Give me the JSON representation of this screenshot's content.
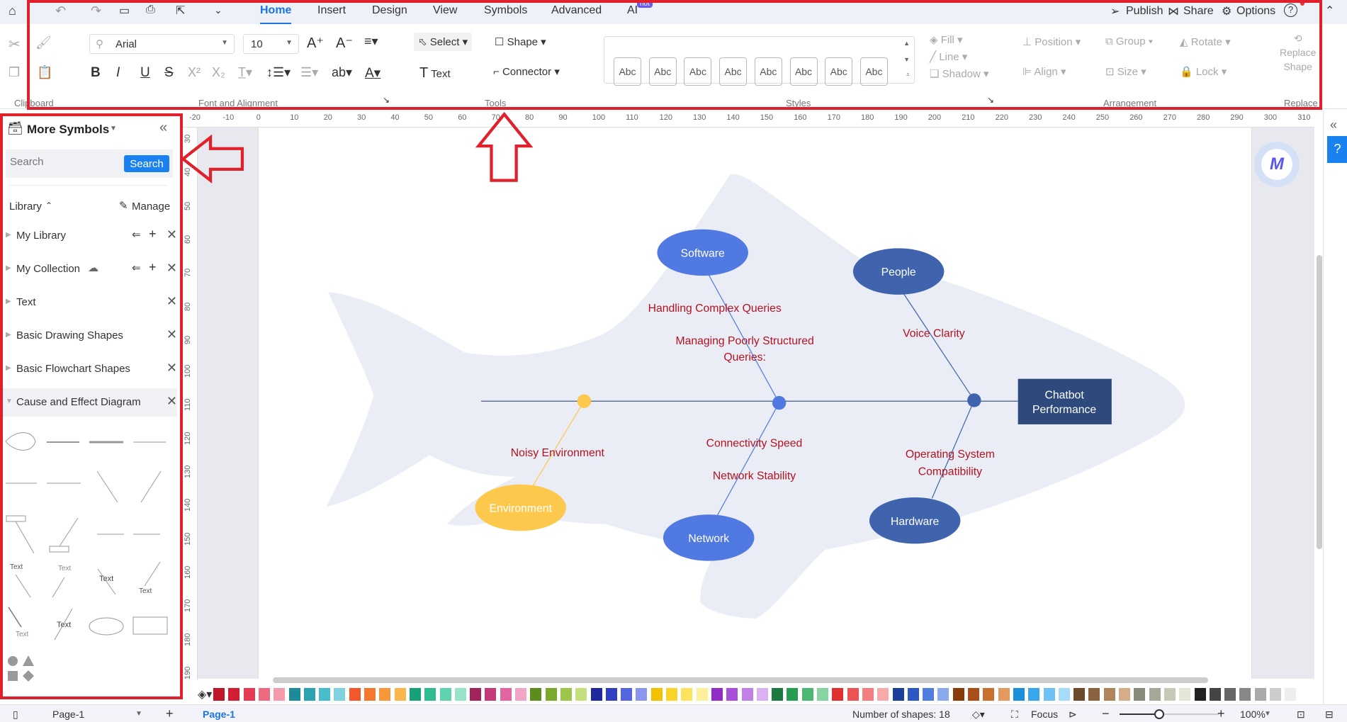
{
  "tabbar": {
    "tabs": [
      "Home",
      "Insert",
      "Design",
      "View",
      "Symbols",
      "Advanced",
      "AI"
    ],
    "active": "Home",
    "ai_badge": "hot",
    "right": {
      "publish": "Publish",
      "share": "Share",
      "options": "Options"
    }
  },
  "ribbon": {
    "font": {
      "name": "Arial",
      "size": "10"
    },
    "tools": {
      "select": "Select",
      "shape": "Shape",
      "text": "Text",
      "connector": "Connector"
    },
    "styles": {
      "swatches": [
        "Abc",
        "Abc",
        "Abc",
        "Abc",
        "Abc",
        "Abc",
        "Abc",
        "Abc"
      ],
      "fill": "Fill",
      "line": "Line",
      "shadow": "Shadow"
    },
    "arrangement": {
      "position": "Position",
      "group": "Group",
      "rotate": "Rotate",
      "align": "Align",
      "size": "Size",
      "lock": "Lock"
    },
    "replace": {
      "label1": "Replace",
      "label2": "Shape"
    },
    "groups": {
      "clipboard": "Clipboard",
      "font": "Font and Alignment",
      "tools": "Tools",
      "styles": "Styles",
      "arrangement": "Arrangement",
      "replace": "Replace"
    }
  },
  "rulers": {
    "horizontal": [
      "-20",
      "-10",
      "0",
      "10",
      "20",
      "30",
      "40",
      "50",
      "60",
      "70",
      "80",
      "90",
      "100",
      "110",
      "120",
      "130",
      "140",
      "150",
      "160",
      "170",
      "180",
      "190",
      "200",
      "210",
      "220",
      "230",
      "240",
      "250",
      "260",
      "270",
      "280",
      "290",
      "300",
      "310"
    ],
    "vertical": [
      "30",
      "40",
      "50",
      "60",
      "70",
      "80",
      "90",
      "100",
      "110",
      "120",
      "130",
      "140",
      "150",
      "160",
      "170",
      "180",
      "190"
    ]
  },
  "sidebar": {
    "title": "More Symbols",
    "search_placeholder": "Search",
    "search_button": "Search",
    "library": "Library",
    "manage": "Manage",
    "items": [
      {
        "label": "My Library",
        "expanded": false
      },
      {
        "label": "My Collection",
        "expanded": false
      },
      {
        "label": "Text",
        "expanded": false
      },
      {
        "label": "Basic Drawing Shapes",
        "expanded": false
      },
      {
        "label": "Basic Flowchart Shapes",
        "expanded": false
      },
      {
        "label": "Cause and Effect Diagram",
        "expanded": true
      }
    ],
    "shape_text": "Text"
  },
  "diagram": {
    "effect": "Chatbot Performance",
    "effect_lines": [
      "Chatbot",
      "Performance"
    ],
    "categories": [
      {
        "name": "Software",
        "color": "#5079e2"
      },
      {
        "name": "People",
        "color": "#3f63ad"
      },
      {
        "name": "Hardware",
        "color": "#3f63ad"
      },
      {
        "name": "Network",
        "color": "#5079e2"
      },
      {
        "name": "Environment",
        "color": "#fdc94c"
      }
    ],
    "causes": {
      "handling": "Handling Complex Queries",
      "managing1": "Managing Poorly Structured",
      "managing2": "Queries:",
      "voice": "Voice Clarity",
      "noisy": "Noisy Environment",
      "connectivity": "Connectivity Speed",
      "stability": "Network Stability",
      "os1": "Operating System",
      "os2": "Compatibility"
    },
    "cause_color": "#b3121f",
    "effect_color": "#2e4a7d",
    "fish_color": "#eaedf6"
  },
  "palette": [
    "#c0182b",
    "#d21d35",
    "#e53a54",
    "#ef6a80",
    "#f59aaa",
    "#1e8a99",
    "#2aa3b3",
    "#49bccb",
    "#7fd3de",
    "#f2582a",
    "#f5782f",
    "#f8973a",
    "#fbb649",
    "#17a07a",
    "#2ebc92",
    "#5fd3ae",
    "#98e3c9",
    "#a2245a",
    "#c4397a",
    "#e065a0",
    "#f3a5c8",
    "#5d8c1c",
    "#7aa92b",
    "#9cc64a",
    "#c4e07e",
    "#1e2a9c",
    "#3040c4",
    "#5566de",
    "#8c96ef",
    "#f2c200",
    "#f8d42a",
    "#fbe35e",
    "#fdf09a",
    "#8e2ec4",
    "#a84fdb",
    "#c27fe8",
    "#dbb1f2",
    "#1b7a3e",
    "#2a9b52",
    "#4db872",
    "#86d4a1",
    "#e03030",
    "#ec5353",
    "#f47d7d",
    "#f8a9a9",
    "#1d3f9c",
    "#2b58c4",
    "#4f7ee0",
    "#8aa9ee",
    "#8a3b0c",
    "#a9501a",
    "#c8712f",
    "#e39a5c",
    "#1b8fd8",
    "#36a8ee",
    "#6cc2f4",
    "#a7dcf9",
    "#6b4a2a",
    "#8a6240",
    "#b0845c",
    "#d6ad88",
    "#8a8a7a",
    "#a8a898",
    "#c8c8b8",
    "#e6e6d8",
    "#222222",
    "#444444",
    "#666666",
    "#888888",
    "#aaaaaa",
    "#cccccc",
    "#eeeeee"
  ],
  "status": {
    "page_tab": "Page-1",
    "active_page": "Page-1",
    "shapes": "Number of shapes: 18",
    "focus": "Focus",
    "zoom": "100%",
    "zoom_level": 100
  }
}
